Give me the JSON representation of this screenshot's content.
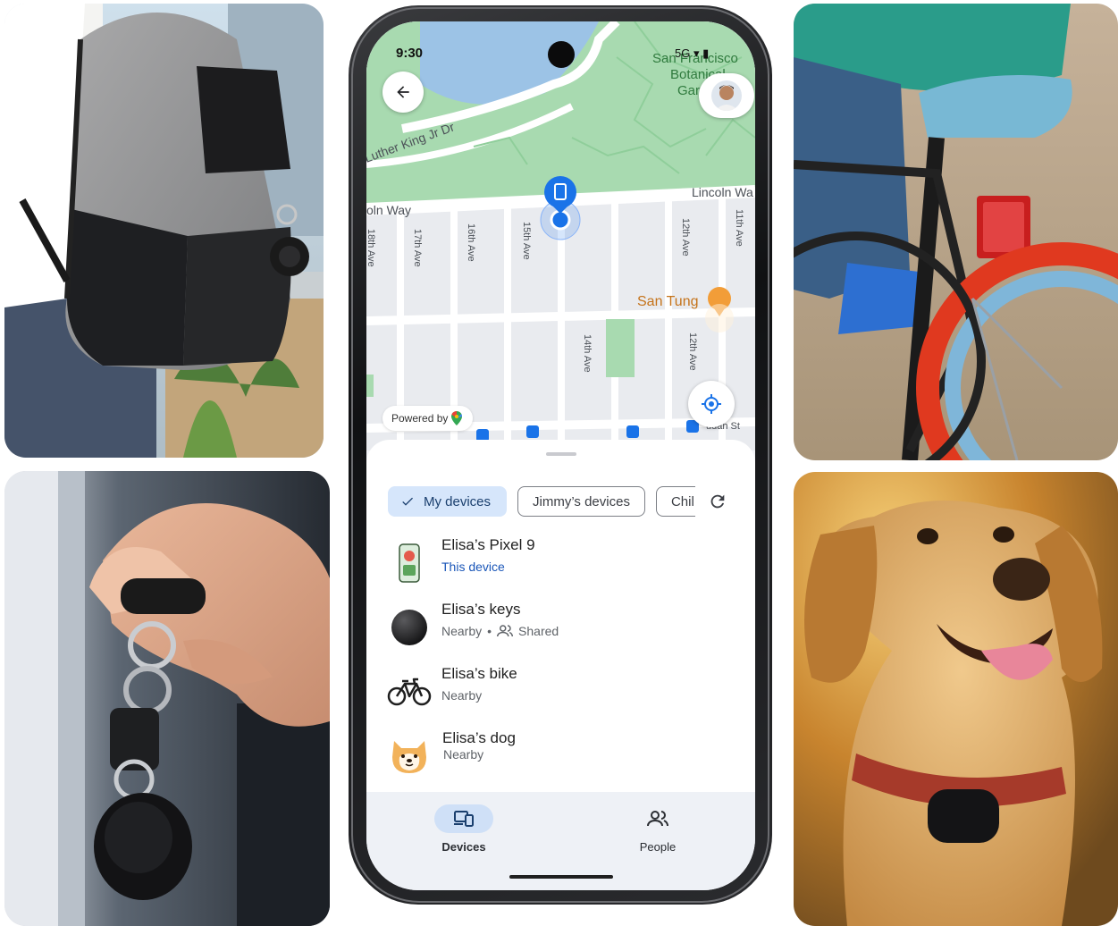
{
  "phone": {
    "status_time": "9:30",
    "status_icons": "5G ▾ ▮",
    "map": {
      "street_labels": [
        "Luther King Jr Dr",
        "Lincoln Wa",
        "oln Way",
        "17th Ave",
        "16th Ave",
        "15th Ave",
        "12th Ave",
        "11th Ave",
        "14th Ave",
        "12th Ave",
        "18th Ave",
        "San Francisco",
        "Botanical",
        "Gar",
        "udah St"
      ],
      "poi_name": "San Tung",
      "powered_by": "Powered by",
      "colors": {
        "park": "#a8dab0",
        "park_dark": "#8fce9a",
        "water": "#9cc3e6",
        "street": "#ffffff",
        "block": "#e9ebef",
        "marker": "#1a73e8",
        "poi": "#f29d38"
      }
    },
    "icons": {
      "back": "arrow-back-icon",
      "avatar": "user-avatar",
      "locate": "my-location-icon",
      "refresh": "refresh-icon",
      "check": "check-icon",
      "shared": "people-icon",
      "devices": "devices-icon",
      "people": "people-icon"
    },
    "chips": [
      {
        "label": "My devices",
        "selected": true
      },
      {
        "label": "Jimmy’s devices",
        "selected": false
      },
      {
        "label": "Chil",
        "selected": false
      }
    ],
    "devices": [
      {
        "name": "Elisa’s Pixel 9",
        "status": "This device",
        "icon": "phone-thumbnail"
      },
      {
        "name": "Elisa’s keys",
        "status": "Nearby",
        "extra": "Shared",
        "icon": "tracker-tag-icon"
      },
      {
        "name": "Elisa’s bike",
        "status": "Nearby",
        "icon": "bicycle-icon"
      },
      {
        "name": "Elisa’s dog",
        "status": "Nearby",
        "icon": "dog-emoji-icon"
      }
    ],
    "nav": [
      {
        "label": "Devices",
        "active": true
      },
      {
        "label": "People",
        "active": false
      }
    ]
  },
  "photos": [
    {
      "subject": "backpack-with-tracker"
    },
    {
      "subject": "keyring-with-tracker"
    },
    {
      "subject": "bicycle-with-tracker"
    },
    {
      "subject": "dog-collar-with-tracker"
    }
  ]
}
